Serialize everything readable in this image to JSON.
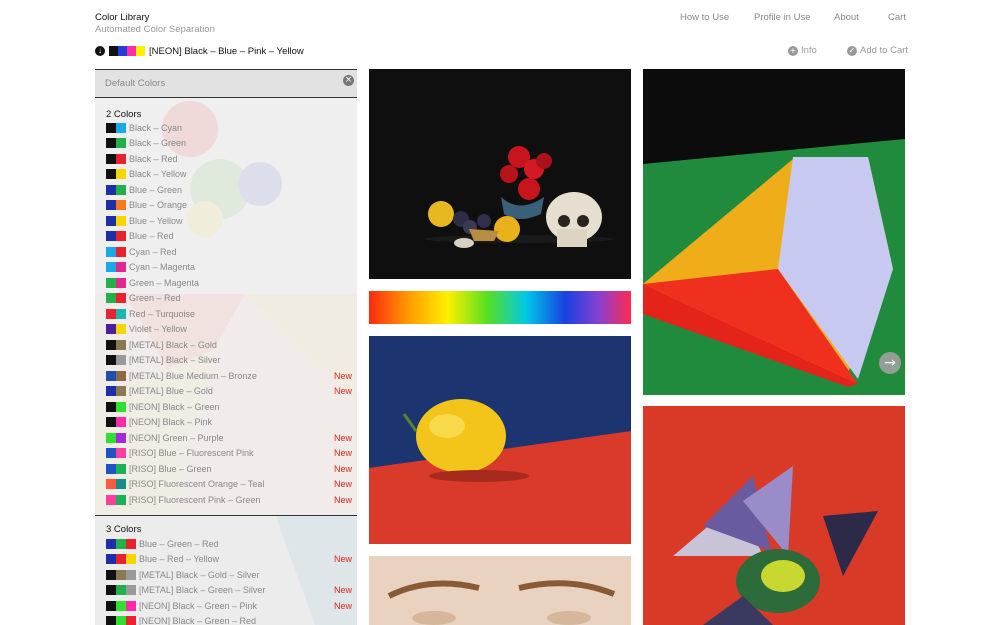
{
  "brand": {
    "title": "Color Library",
    "subtitle": "Automated Color Separation"
  },
  "nav": {
    "how_to_use": "How to Use",
    "profile_in_use": "Profile in Use",
    "about": "About",
    "cart": "Cart"
  },
  "selected_palette": {
    "label": "[NEON] Black – Blue – Pink – Yellow",
    "swatches": [
      "#111111",
      "#1f3fdc",
      "#ff2aa5",
      "#fff200"
    ],
    "download_icon": "download-icon"
  },
  "actions": {
    "info": "Info",
    "add_to_cart": "Add to Cart",
    "info_icon": "plus-circle-icon",
    "cart_icon": "check-circle-icon"
  },
  "search": {
    "placeholder": "Default Colors"
  },
  "sections": [
    {
      "title": "2 Colors",
      "items": [
        {
          "label": "Black – Cyan",
          "colors": [
            "#111111",
            "#18a9e6"
          ],
          "new": ""
        },
        {
          "label": "Black – Green",
          "colors": [
            "#111111",
            "#22b04b"
          ],
          "new": ""
        },
        {
          "label": "Black – Red",
          "colors": [
            "#111111",
            "#e8232f"
          ],
          "new": ""
        },
        {
          "label": "Black – Yellow",
          "colors": [
            "#111111",
            "#f7d600"
          ],
          "new": ""
        },
        {
          "label": "Blue – Green",
          "colors": [
            "#1c2fa8",
            "#22b04b"
          ],
          "new": ""
        },
        {
          "label": "Blue – Orange",
          "colors": [
            "#1c2fa8",
            "#f47a1f"
          ],
          "new": ""
        },
        {
          "label": "Blue – Yellow",
          "colors": [
            "#1c2fa8",
            "#f7d600"
          ],
          "new": ""
        },
        {
          "label": "Blue – Red",
          "colors": [
            "#1c2fa8",
            "#e8232f"
          ],
          "new": ""
        },
        {
          "label": "Cyan – Red",
          "colors": [
            "#18a9e6",
            "#e8232f"
          ],
          "new": ""
        },
        {
          "label": "Cyan – Magenta",
          "colors": [
            "#18a9e6",
            "#e0288f"
          ],
          "new": ""
        },
        {
          "label": "Green – Magenta",
          "colors": [
            "#22b04b",
            "#e0288f"
          ],
          "new": ""
        },
        {
          "label": "Green – Red",
          "colors": [
            "#22b04b",
            "#e8232f"
          ],
          "new": ""
        },
        {
          "label": "Red – Turquoise",
          "colors": [
            "#e8232f",
            "#18b8b0"
          ],
          "new": ""
        },
        {
          "label": "Violet – Yellow",
          "colors": [
            "#4b1fa0",
            "#f7d600"
          ],
          "new": ""
        },
        {
          "label": "[METAL] Black – Gold",
          "colors": [
            "#111111",
            "#8a7a52"
          ],
          "new": ""
        },
        {
          "label": "[METAL] Black – Silver",
          "colors": [
            "#111111",
            "#9a9a9a"
          ],
          "new": ""
        },
        {
          "label": "[METAL] Blue Medium – Bronze",
          "colors": [
            "#1f4fa8",
            "#8b6b45"
          ],
          "new": "New"
        },
        {
          "label": "[METAL] Blue – Gold",
          "colors": [
            "#1c2fa8",
            "#8a7a52"
          ],
          "new": "New"
        },
        {
          "label": "[NEON] Black – Green",
          "colors": [
            "#111111",
            "#2fe02f"
          ],
          "new": ""
        },
        {
          "label": "[NEON] Black – Pink",
          "colors": [
            "#111111",
            "#ff2aa5"
          ],
          "new": ""
        },
        {
          "label": "[NEON] Green – Purple",
          "colors": [
            "#2fe02f",
            "#a32ad8"
          ],
          "new": "New"
        },
        {
          "label": "[RISO] Blue – Fluorescent Pink",
          "colors": [
            "#1d55c8",
            "#ff3fa0"
          ],
          "new": "New"
        },
        {
          "label": "[RISO] Blue – Green",
          "colors": [
            "#1d55c8",
            "#1fae5a"
          ],
          "new": "New"
        },
        {
          "label": "[RISO] Fluorescent Orange – Teal",
          "colors": [
            "#ff5a3c",
            "#178c8a"
          ],
          "new": "New"
        },
        {
          "label": "[RISO] Fluorescent Pink – Green",
          "colors": [
            "#ff3fa0",
            "#1fae5a"
          ],
          "new": "New"
        }
      ]
    },
    {
      "title": "3 Colors",
      "items": [
        {
          "label": "Blue – Green – Red",
          "colors": [
            "#1c2fa8",
            "#22b04b",
            "#e8232f"
          ],
          "new": ""
        },
        {
          "label": "Blue – Red – Yellow",
          "colors": [
            "#1c2fa8",
            "#e8232f",
            "#f7d600"
          ],
          "new": "New"
        },
        {
          "label": "[METAL] Black – Gold – Silver",
          "colors": [
            "#111111",
            "#8a7a52",
            "#9a9a9a"
          ],
          "new": ""
        },
        {
          "label": "[METAL] Black – Green – Silver",
          "colors": [
            "#111111",
            "#22b04b",
            "#9a9a9a"
          ],
          "new": "New"
        },
        {
          "label": "[NEON] Black – Green – Pink",
          "colors": [
            "#111111",
            "#2fe02f",
            "#ff2aa5"
          ],
          "new": "New"
        },
        {
          "label": "[NEON] Black – Green – Red",
          "colors": [
            "#111111",
            "#2fe02f",
            "#e8232f"
          ],
          "new": ""
        }
      ]
    }
  ],
  "gallery": {
    "next_icon": "arrow-right-icon",
    "images": [
      "still-life-photo",
      "spectrum-gradient",
      "isometric-cube-photo",
      "lemon-photo",
      "bird-photo",
      "face-photo"
    ]
  }
}
